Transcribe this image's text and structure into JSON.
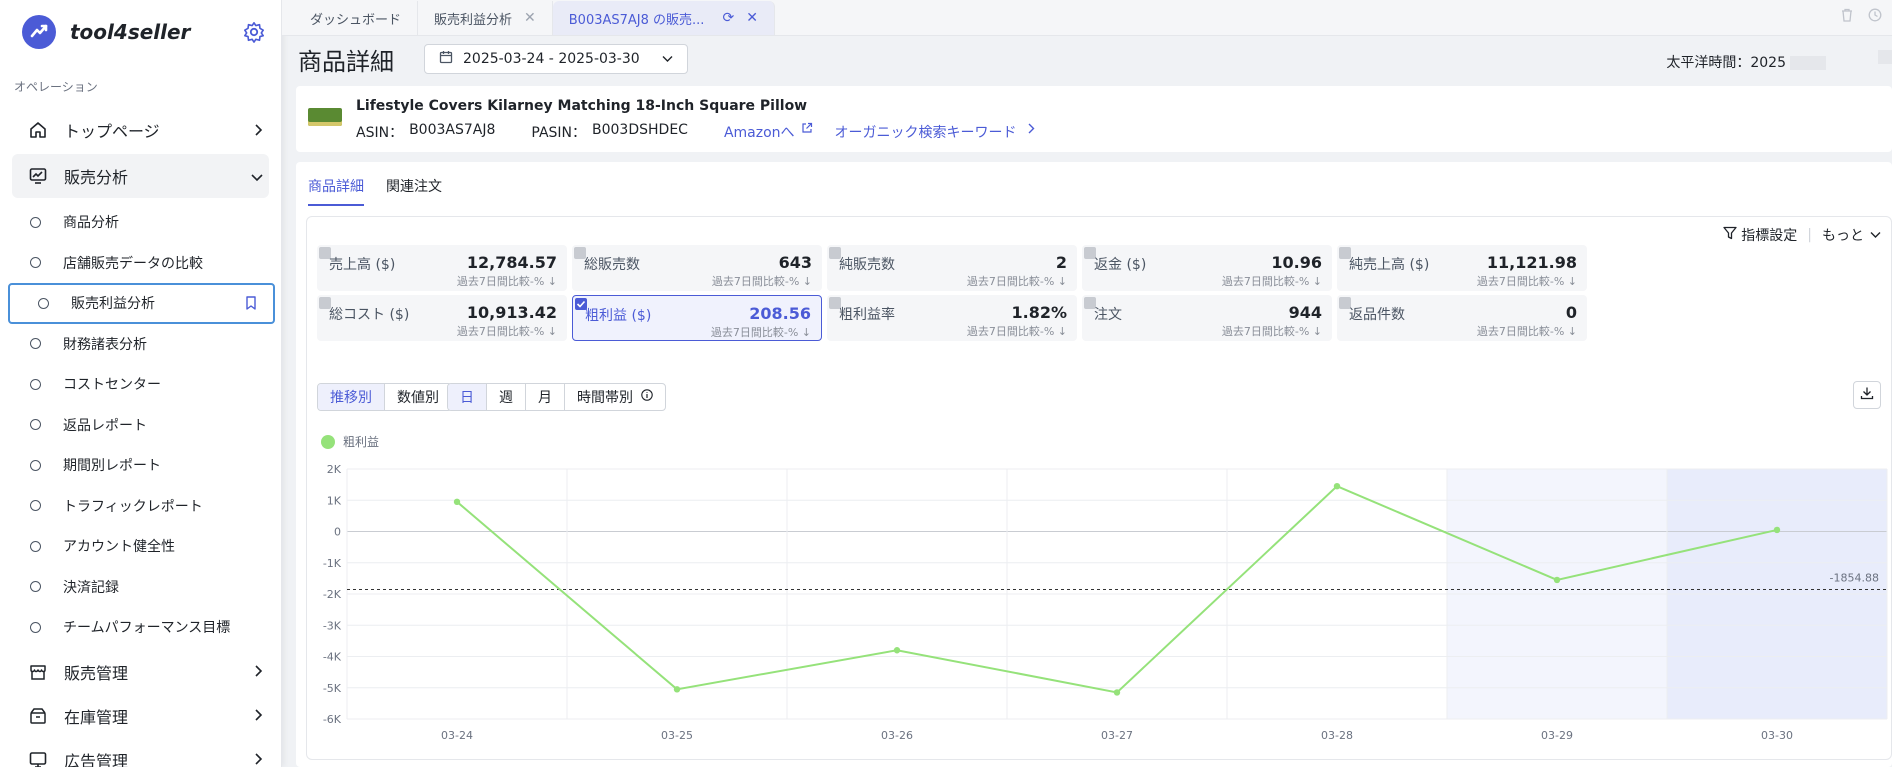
{
  "app": {
    "name": "tool4seller",
    "brand_color": "#4b5bd6",
    "section_label": "オペレーション"
  },
  "sidebar": {
    "groups": [
      {
        "label": "トップページ",
        "icon": "home-icon"
      },
      {
        "label": "販売分析",
        "icon": "chart-monitor-icon"
      }
    ],
    "sub_items": [
      "商品分析",
      "店舗販売データの比較",
      "販売利益分析",
      "財務諸表分析",
      "コストセンター",
      "返品レポート",
      "期間別レポート",
      "トラフィックレポート",
      "アカウント健全性",
      "決済記録",
      "チームパフォーマンス目標"
    ],
    "active_sub_item": "販売利益分析",
    "bottom_groups": [
      {
        "label": "販売管理",
        "icon": "store-icon"
      },
      {
        "label": "在庫管理",
        "icon": "box-icon"
      },
      {
        "label": "広告管理",
        "icon": "monitor-icon"
      }
    ]
  },
  "tabs": [
    {
      "label": "ダッシュボード"
    },
    {
      "label": "販売利益分析"
    },
    {
      "label": "B003AS7AJ8 の販売...",
      "active": true
    }
  ],
  "header": {
    "title": "商品詳細",
    "date_range": "2025-03-24 - 2025-03-30",
    "timezone_label": "太平洋時間：2025"
  },
  "product": {
    "title": "Lifestyle Covers Kilarney Matching 18-Inch Square Pillow",
    "asin_label": "ASIN：",
    "asin": "B003AS7AJ8",
    "pasin_label": "PASIN：",
    "pasin": "B003DSHDEC",
    "amazon_link": "Amazonへ",
    "keyword_link": "オーガニック検索キーワード"
  },
  "content_tabs": [
    "商品詳細",
    "関連注文"
  ],
  "metric_tools": {
    "settings": "指標設定",
    "more": "もっと"
  },
  "metrics": [
    {
      "name": "売上高 ($)",
      "value": "12,784.57",
      "compare": "過去7日間比較-%"
    },
    {
      "name": "総販売数",
      "value": "643",
      "compare": "過去7日間比較-%"
    },
    {
      "name": "純販売数",
      "value": "2",
      "compare": "過去7日間比較-%"
    },
    {
      "name": "返金 ($)",
      "value": "10.96",
      "compare": "過去7日間比較-%"
    },
    {
      "name": "純売上高 ($)",
      "value": "11,121.98",
      "compare": "過去7日間比較-%"
    },
    {
      "name": "総コスト ($)",
      "value": "10,913.42",
      "compare": "過去7日間比較-%"
    },
    {
      "name": "粗利益 ($)",
      "value": "208.56",
      "compare": "過去7日間比較-%",
      "selected": true
    },
    {
      "name": "粗利益率",
      "value": "1.82%",
      "compare": "過去7日間比較-%"
    },
    {
      "name": "注文",
      "value": "944",
      "compare": "過去7日間比較-%"
    },
    {
      "name": "返品件数",
      "value": "0",
      "compare": "過去7日間比較-%"
    }
  ],
  "view_toggle": [
    "推移別",
    "数値別"
  ],
  "period_toggle": [
    "日",
    "週",
    "月",
    "時間帯別"
  ],
  "chart_data": {
    "type": "line",
    "x": [
      "03-24",
      "03-25",
      "03-26",
      "03-27",
      "03-28",
      "03-29",
      "03-30"
    ],
    "series": [
      {
        "name": "粗利益",
        "values": [
          950,
          -5050,
          -3800,
          -5150,
          1450,
          -1550,
          50
        ],
        "color": "#95e27a"
      }
    ],
    "y_ticks": [
      "2K",
      "1K",
      "0",
      "-1K",
      "-2K",
      "-3K",
      "-4K",
      "-5K",
      "-6K"
    ],
    "ylim": [
      -6000,
      2000
    ],
    "reference_line": {
      "value": -1854.88,
      "label": "-1854.88"
    },
    "highlight_categories": [
      "03-29",
      "03-30"
    ],
    "grid": true
  }
}
